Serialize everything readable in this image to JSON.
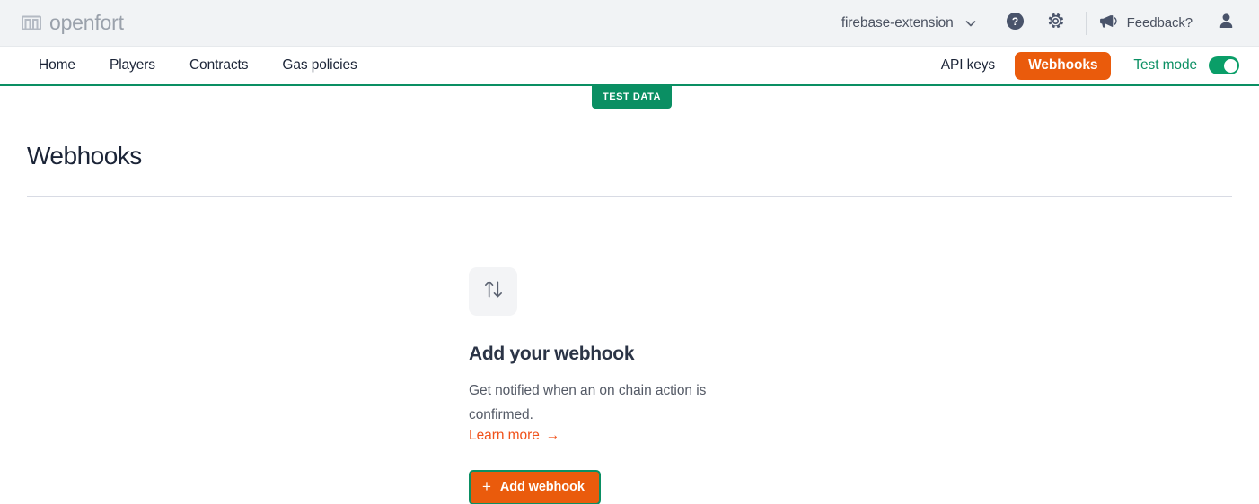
{
  "header": {
    "brand_name": "openfort",
    "brand_mark_icon": "openfort-logo-icon",
    "org_name": "firebase-extension",
    "chevron_icon": "chevron-down-icon",
    "help_icon": "help-circle-icon",
    "settings_icon": "gear-icon",
    "megaphone_icon": "megaphone-icon",
    "feedback_label": "Feedback?",
    "avatar_icon": "user-avatar-icon"
  },
  "nav": {
    "links": [
      {
        "label": "Home"
      },
      {
        "label": "Players"
      },
      {
        "label": "Contracts"
      },
      {
        "label": "Gas policies"
      }
    ],
    "api_keys_label": "API keys",
    "webhooks_label": "Webhooks",
    "test_mode_label": "Test mode",
    "test_mode_on": true
  },
  "test_data_badge": "TEST DATA",
  "main": {
    "page_title": "Webhooks",
    "empty_state": {
      "icon": "arrows-up-down-icon",
      "heading": "Add your webhook",
      "description": "Get notified when an on chain action is confirmed.",
      "learn_more_label": "Learn more",
      "learn_more_arrow": "→",
      "add_button_label": "Add webhook",
      "add_button_plus": "+"
    }
  },
  "colors": {
    "brand_orange": "#ea5b0c",
    "link_orange": "#f0531c",
    "brand_green": "#0a8f63",
    "toggle_green": "#0a9e68",
    "header_bg": "#f1f3f5",
    "text_dark": "#1b2437",
    "text_muted": "#545a66"
  }
}
